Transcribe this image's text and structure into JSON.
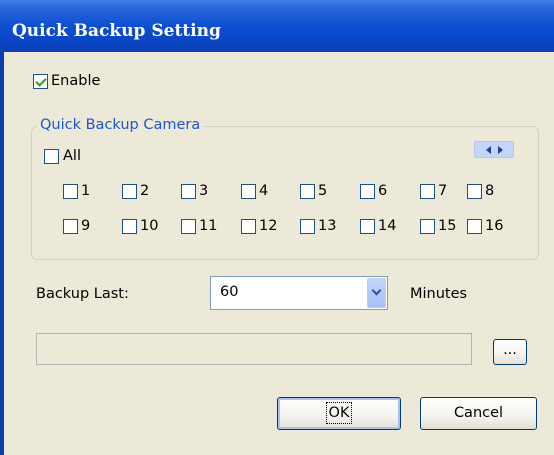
{
  "window": {
    "title": "Quick Backup Setting"
  },
  "enable": {
    "label": "Enable",
    "checked": true
  },
  "group": {
    "title": "Quick Backup Camera",
    "all_label": "All",
    "all_checked": false,
    "nav_arrows": [
      "arrow-left-icon",
      "arrow-right-icon"
    ],
    "cameras": [
      "1",
      "2",
      "3",
      "4",
      "5",
      "6",
      "7",
      "8",
      "9",
      "10",
      "11",
      "12",
      "13",
      "14",
      "15",
      "16"
    ]
  },
  "backup_last": {
    "label": "Backup Last:",
    "value": "60",
    "unit": "Minutes"
  },
  "path": {
    "value": "",
    "browse_label": "..."
  },
  "buttons": {
    "ok": "OK",
    "cancel": "Cancel"
  },
  "colors": {
    "title_bar": "#0a45c4",
    "group_title": "#1f54d6",
    "background": "#ece9d8"
  }
}
